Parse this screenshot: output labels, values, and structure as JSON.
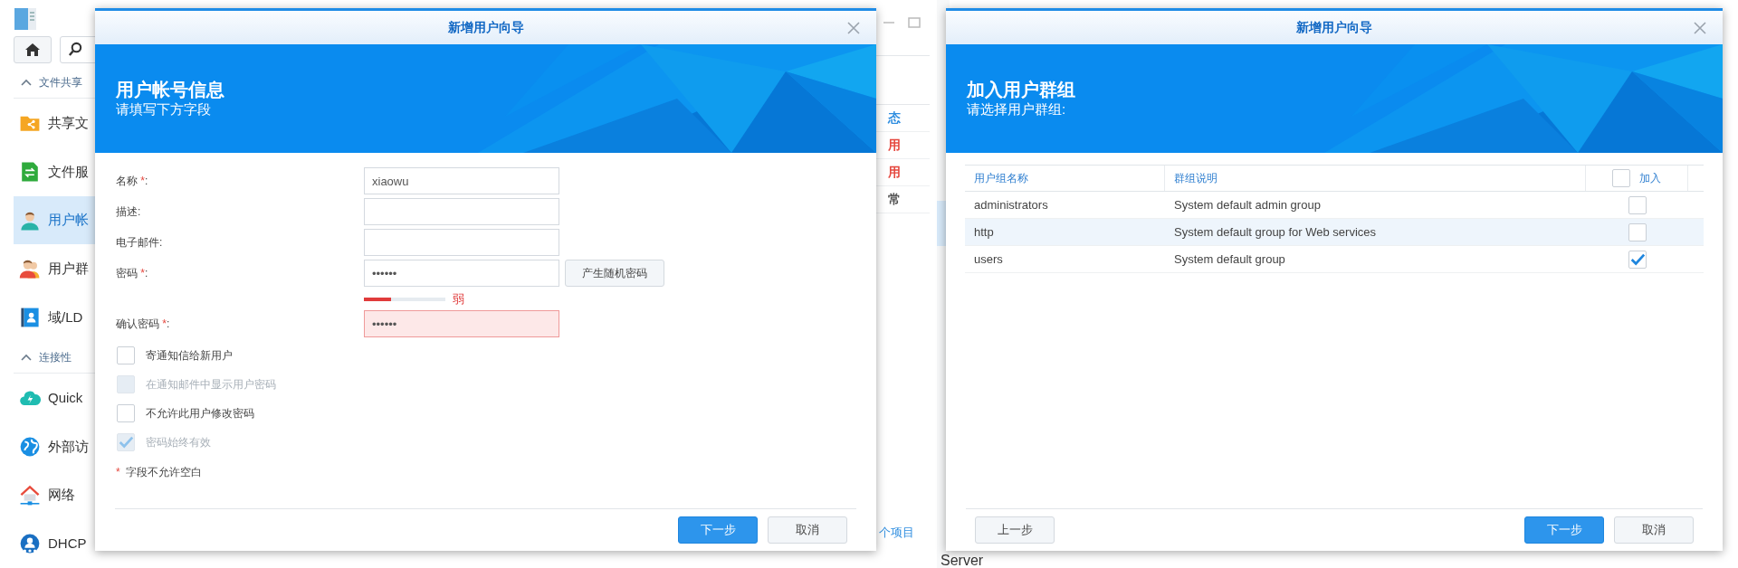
{
  "left_screen": {
    "background_app": {
      "sidebar": [
        {
          "kind": "header",
          "label": "文件共享",
          "expanded": true
        },
        {
          "kind": "item",
          "label": "共享文",
          "selected": false
        },
        {
          "kind": "item",
          "label": "文件服",
          "selected": false
        },
        {
          "kind": "item",
          "label": "用户帐",
          "selected": true
        },
        {
          "kind": "item",
          "label": "用户群",
          "selected": false
        },
        {
          "kind": "item",
          "label": "域/LD",
          "selected": false
        },
        {
          "kind": "header",
          "label": "连接性",
          "expanded": true
        },
        {
          "kind": "item",
          "label": "Quick",
          "selected": false
        },
        {
          "kind": "item",
          "label": "外部访",
          "selected": false
        },
        {
          "kind": "item",
          "label": "网络",
          "selected": false
        },
        {
          "kind": "item",
          "label": "DHCP",
          "selected": false
        }
      ],
      "status_column": [
        {
          "text": "态",
          "color": "#2f8ee0"
        },
        {
          "text": "用",
          "color": "#e5483f"
        },
        {
          "text": "用",
          "color": "#e5483f"
        },
        {
          "text": "常",
          "color": "#555555"
        }
      ],
      "footer_text": "个项目"
    },
    "dialog": {
      "title": "新增用户向导",
      "heading": "用户帐号信息",
      "subheading": "请填写下方字段",
      "fields": [
        {
          "label": "名称",
          "required_mark": "*",
          "colon": ":",
          "value": "xiaowu",
          "invalid": false
        },
        {
          "label": "描述:",
          "invalid": false
        },
        {
          "label": "电子邮件:",
          "invalid": false
        },
        {
          "label": "密码",
          "required_mark": "*",
          "colon": ":",
          "value": "••••••",
          "invalid": false,
          "button": "产生随机密码",
          "strength": {
            "level": 0.33,
            "reading": "弱"
          }
        },
        {
          "label": "确认密码",
          "required_mark": "*",
          "colon": ":",
          "value": "••••••",
          "invalid": true
        }
      ],
      "checkboxes": [
        {
          "label": "寄通知信给新用户",
          "checked": false,
          "disabled": false
        },
        {
          "label": "在通知邮件中显示用户密码",
          "checked": false,
          "disabled": true
        },
        {
          "label": "不允许此用户修改密码",
          "checked": false,
          "disabled": false
        },
        {
          "label": "密码始终有效",
          "checked": true,
          "disabled": true
        }
      ],
      "footnote": {
        "mark": "*",
        "text": "字段不允许空白"
      },
      "buttons": [
        {
          "label": "下一步",
          "primary": true
        },
        {
          "label": "取消",
          "primary": false
        }
      ]
    }
  },
  "right_screen": {
    "background_app": {
      "sidebar_text": "Server"
    },
    "dialog": {
      "title": "新增用户向导",
      "heading": "加入用户群组",
      "subheading": "请选择用户群组:",
      "table": {
        "columns": [
          {
            "label": "用户组名称"
          },
          {
            "label": "群组说明"
          },
          {
            "label": "加入",
            "checked": false
          }
        ],
        "rows": [
          {
            "name": "administrators",
            "description": "System default admin group",
            "joined": false,
            "highlighted": false
          },
          {
            "name": "http",
            "description": "System default group for Web services",
            "joined": false,
            "highlighted": true
          },
          {
            "name": "users",
            "description": "System default group",
            "joined": true,
            "highlighted": false
          }
        ]
      },
      "buttons_left": [
        {
          "label": "上一步",
          "primary": false
        }
      ],
      "buttons": [
        {
          "label": "下一步",
          "primary": true
        },
        {
          "label": "取消",
          "primary": false
        }
      ]
    }
  }
}
